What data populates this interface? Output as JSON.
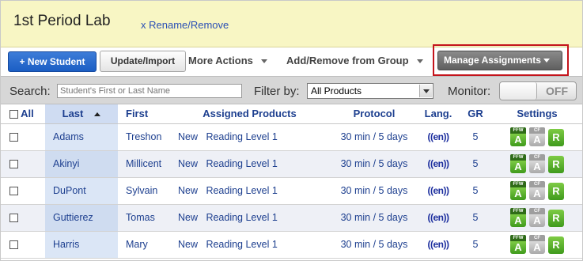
{
  "header": {
    "title": "1st Period Lab",
    "rename_link": "x Rename/Remove"
  },
  "toolbar": {
    "new_student": "+ New Student",
    "update_import": "Update/Import",
    "more_actions": "More Actions",
    "add_remove_group": "Add/Remove from Group",
    "manage_assignments": "Manage Assignments"
  },
  "searchbar": {
    "search_label": "Search:",
    "search_placeholder": "Student's First or Last Name",
    "filter_label": "Filter by:",
    "filter_value": "All Products",
    "monitor_label": "Monitor:",
    "monitor_state": "OFF"
  },
  "table": {
    "headers": {
      "all": "All",
      "last": "Last",
      "first": "First",
      "products": "Assigned Products",
      "protocol": "Protocol",
      "lang": "Lang.",
      "gr": "GR",
      "settings": "Settings"
    },
    "rows": [
      {
        "last": "Adams",
        "first": "Treshon",
        "status": "New",
        "product": "Reading Level 1",
        "protocol": "30 min / 5 days",
        "lang": "((en))",
        "gr": "5"
      },
      {
        "last": "Akinyi",
        "first": "Millicent",
        "status": "New",
        "product": "Reading Level 1",
        "protocol": "30 min / 5 days",
        "lang": "((en))",
        "gr": "5"
      },
      {
        "last": "DuPont",
        "first": "Sylvain",
        "status": "New",
        "product": "Reading Level 1",
        "protocol": "30 min / 5 days",
        "lang": "((en))",
        "gr": "5"
      },
      {
        "last": "Guttierez",
        "first": "Tomas",
        "status": "New",
        "product": "Reading Level 1",
        "protocol": "30 min / 5 days",
        "lang": "((en))",
        "gr": "5"
      },
      {
        "last": "Harris",
        "first": "Mary",
        "status": "New",
        "product": "Reading Level 1",
        "protocol": "30 min / 5 days",
        "lang": "((en))",
        "gr": "5"
      }
    ],
    "settings_badges": {
      "ffw_tag": "FFW",
      "ffw_letter": "A",
      "cf_tag": "CF",
      "cf_letter": "A",
      "r_letter": "R"
    }
  },
  "colors": {
    "accent_blue": "#1b5ec4",
    "highlight_red": "#c4141c",
    "header_yellow": "#f8f6c4",
    "badge_green": "#3f9a1c"
  }
}
